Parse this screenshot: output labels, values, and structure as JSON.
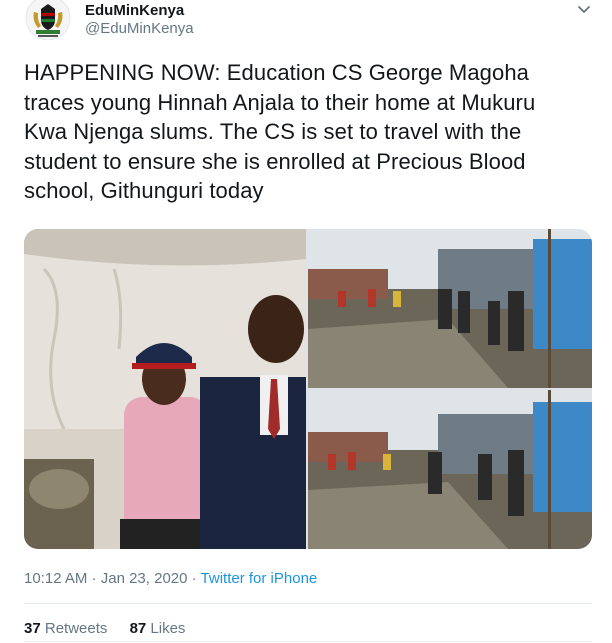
{
  "tweet": {
    "author_name": "EduMinKenya",
    "author_handle": "@EduMinKenya",
    "text": "HAPPENING NOW: Education CS George Magoha traces young Hinnah Anjala to their home at Mukuru Kwa Njenga slums. The CS is set to travel with the student to ensure she is enrolled at Precious Blood school, Githunguri today",
    "time": "10:12 AM",
    "separator": " · ",
    "date": "Jan 23, 2020",
    "separator2": " · ",
    "source": "Twitter for iPhone",
    "retweets_count": "37",
    "retweets_label": " Retweets",
    "likes_count": "87",
    "likes_label": " Likes"
  },
  "icons": {
    "avatar": "coat-of-arms-icon",
    "menu": "chevron-down-icon"
  },
  "colors": {
    "text": "#14171a",
    "secondary": "#657786",
    "link": "#1b95e0",
    "divider": "#e6ecf0"
  }
}
